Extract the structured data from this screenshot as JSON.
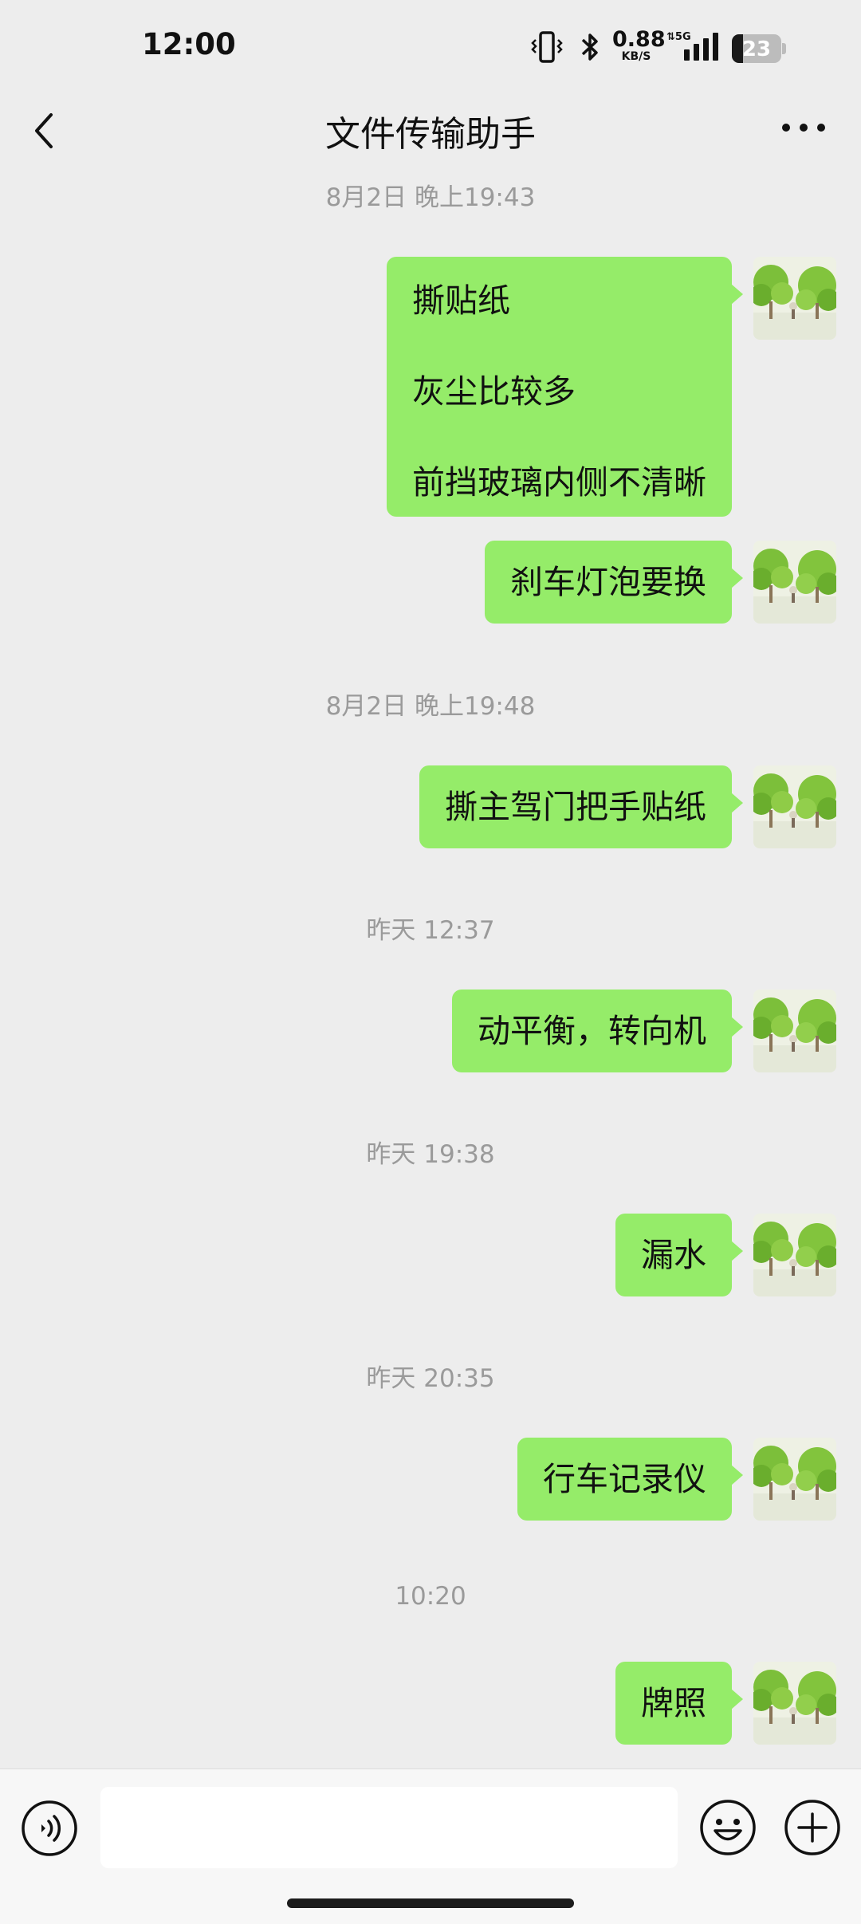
{
  "status_bar": {
    "time": "12:00",
    "net_speed": "0.88",
    "net_speed_unit": "KB/S",
    "network_type": "5G",
    "battery_level": "23"
  },
  "nav": {
    "title": "文件传输助手",
    "back_icon": "chevron-left-icon",
    "more_icon": "more-dots-icon"
  },
  "messages": {
    "ts1": "8月2日 晚上19:43",
    "m1_line1": "撕贴纸",
    "m1_line2": "灰尘比较多",
    "m1_line3": "前挡玻璃内侧不清晰",
    "m2": "刹车灯泡要换",
    "ts2": "8月2日 晚上19:48",
    "m3": "撕主驾门把手贴纸",
    "ts3": "昨天 12:37",
    "m4": "动平衡，转向机",
    "ts4": "昨天 19:38",
    "m5": "漏水",
    "ts5": "昨天 20:35",
    "m6": "行车记录仪",
    "ts6": "10:20",
    "m7": "牌照"
  },
  "input_bar": {
    "text_value": "",
    "voice_icon": "voice-icon",
    "emoji_icon": "emoji-icon",
    "plus_icon": "plus-icon"
  },
  "colors": {
    "background": "#ededed",
    "bubble": "#95ec69",
    "timestamp": "#9a9a9a"
  }
}
